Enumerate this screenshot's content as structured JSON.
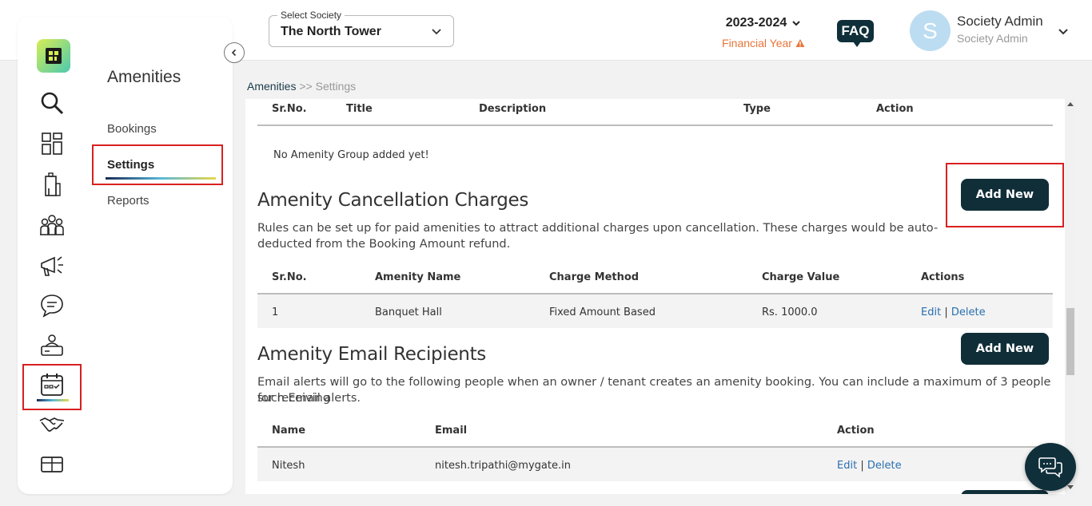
{
  "header": {
    "select_label": "Select Society",
    "society": "The North Tower",
    "year": "2023-2024",
    "fy_label": "Financial Year",
    "faq": "FAQ",
    "avatar_letter": "S",
    "user_name": "Society Admin",
    "user_role": "Society Admin"
  },
  "sidebar": {
    "title": "Amenities",
    "items": [
      {
        "label": "Bookings"
      },
      {
        "label": "Settings"
      },
      {
        "label": "Reports"
      }
    ],
    "icons": [
      "search-icon",
      "dashboard-icon",
      "building-icon",
      "community-icon",
      "announcement-icon",
      "chat-icon",
      "helpdesk-icon",
      "calendar-icon",
      "handshake-icon",
      "storage-icon"
    ]
  },
  "breadcrumb": {
    "root": "Amenities",
    "current": ">> Settings"
  },
  "group_table": {
    "headers": [
      "Sr.No.",
      "Title",
      "Description",
      "Type",
      "Action"
    ],
    "empty": "No Amenity Group added yet!"
  },
  "cancellation": {
    "title": "Amenity Cancellation Charges",
    "desc1": "Rules can be set up for paid amenities to attract additional charges upon cancellation. These charges would be auto-",
    "desc2": "deducted from the Booking Amount refund.",
    "add": "Add New",
    "headers": [
      "Sr.No.",
      "Amenity Name",
      "Charge Method",
      "Charge Value",
      "Actions"
    ],
    "rows": [
      {
        "sr": "1",
        "name": "Banquet Hall",
        "method": "Fixed Amount Based",
        "value": "Rs. 1000.0",
        "edit": "Edit",
        "sep": "|",
        "delete": "Delete"
      }
    ]
  },
  "recipients": {
    "title": "Amenity Email Recipients",
    "desc1": "Email alerts will go to the following people when an owner / tenant creates an amenity booking. You can include a maximum of 3 people for receiving",
    "desc2": "such Email alerts.",
    "add": "Add New",
    "headers": [
      "Name",
      "Email",
      "Action"
    ],
    "rows": [
      {
        "name": "Nitesh",
        "email": "nitesh.tripathi@mygate.in",
        "edit": "Edit",
        "sep": "|",
        "delete": "Delete"
      }
    ]
  },
  "colors": {
    "accent": "#102e38",
    "highlight": "#d92020",
    "warning": "#e8743a",
    "link": "#2a6fb0"
  }
}
